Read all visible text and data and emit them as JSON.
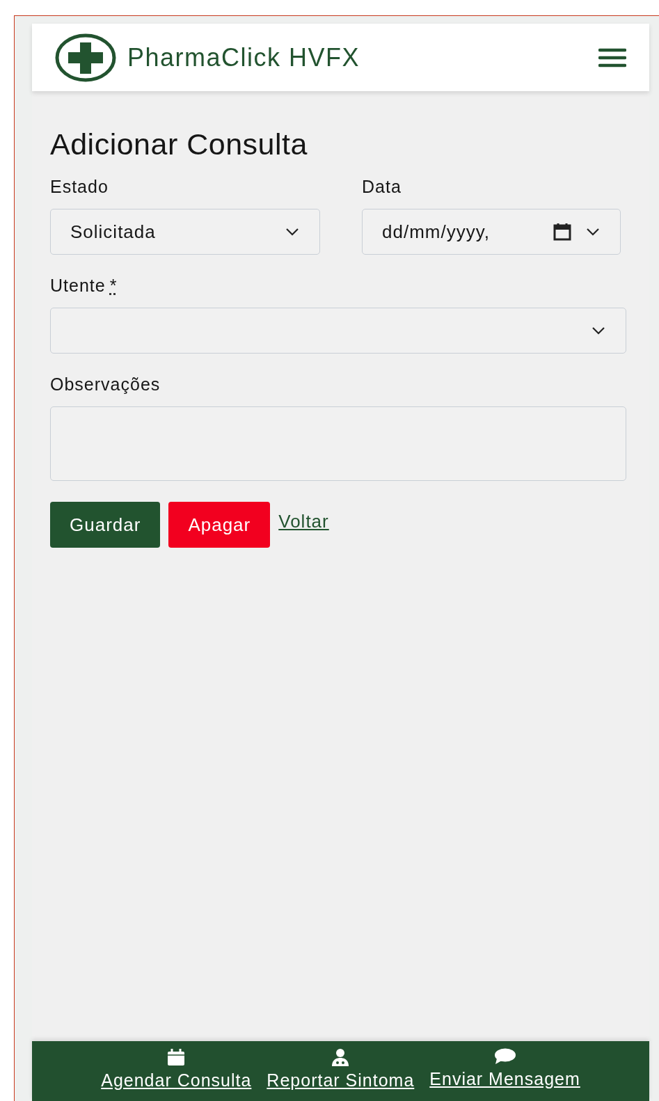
{
  "header": {
    "title": "PharmaClick HVFX"
  },
  "page_title": "Adicionar Consulta",
  "fields": [
    {
      "kind": "select",
      "label": "Estado",
      "value": "Solicitada"
    },
    {
      "kind": "datetime",
      "label": "Data",
      "placeholder": "dd/mm/yyyy,"
    },
    {
      "kind": "select",
      "label": "Utente",
      "required_mark": "*"
    },
    {
      "kind": "textarea",
      "label": "Observações"
    }
  ],
  "buttons": [
    {
      "kind": "primary",
      "label": "Guardar"
    },
    {
      "kind": "danger",
      "label": "Apagar"
    },
    {
      "kind": "link",
      "label": "Voltar"
    }
  ],
  "bottom_nav": [
    {
      "label": "Agendar Consulta"
    },
    {
      "label": "Reportar Sintoma"
    },
    {
      "label": "Enviar Mensagem"
    }
  ]
}
